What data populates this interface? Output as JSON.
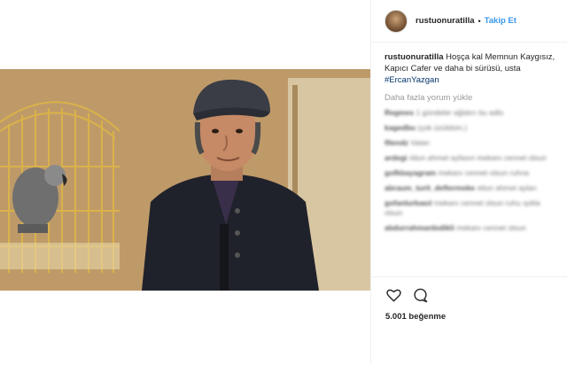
{
  "post": {
    "username": "rustuonuratilla",
    "follow_label": "Takip Et",
    "separator": "•",
    "caption_text": "Hoşça kal Memnun Kaygısız, Kapıcı Cafer ve daha bi sürüsü, usta",
    "caption_hashtag": "#ErcanYazgan",
    "load_more": "Daha fazla yorum yükle",
    "likes": "5.001 beğenme"
  },
  "comments": [
    {
      "user": "Regmes",
      "text": "1 gündeler ağlatırı bu adlo"
    },
    {
      "user": "kagedbu",
      "text": "(çok üzüldüm.)"
    },
    {
      "user": "fllendz",
      "text": "Vatan"
    },
    {
      "user": "ardegi",
      "text": "ıldun ahmet ayfasın mekanı cennet olsun"
    },
    {
      "user": "gofkbayagram",
      "text": "mekanı cennet olsun ruhna"
    },
    {
      "user": "abraum_turit_deftermeke",
      "text": "ıldun ahmet ayları"
    },
    {
      "user": "gofanlurbasıl",
      "text": "mekanı cennet olsun ruhu ışıkla olsun"
    },
    {
      "user": "abdurrahmanbıdikli",
      "text": "mekanı cennet olsun"
    }
  ],
  "icons": {
    "like": "heart-icon",
    "comment": "comment-icon"
  },
  "colors": {
    "link": "#3897f0",
    "hashtag": "#003569",
    "muted": "#999999",
    "text": "#262626"
  }
}
